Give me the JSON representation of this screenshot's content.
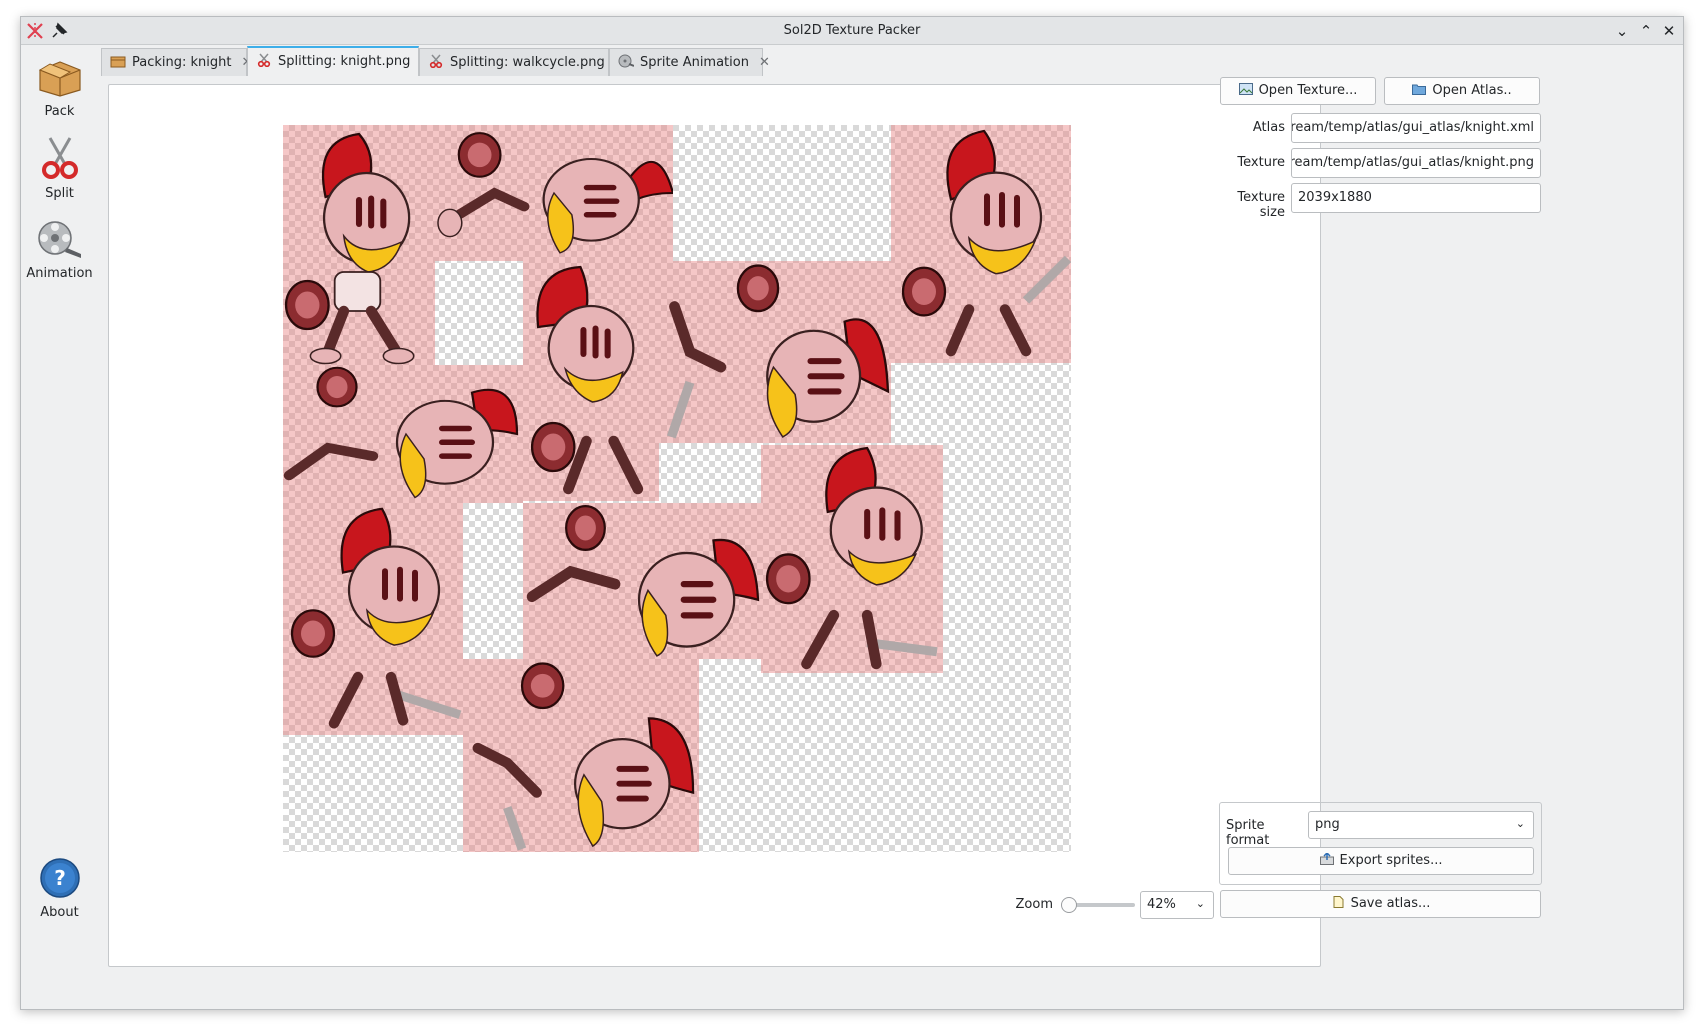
{
  "window": {
    "title": "Sol2D Texture Packer"
  },
  "sidebar": {
    "items": [
      {
        "label": "Pack",
        "icon": "box-icon"
      },
      {
        "label": "Split",
        "icon": "scissors-icon"
      },
      {
        "label": "Animation",
        "icon": "film-reel-icon"
      },
      {
        "label": "About",
        "icon": "help-icon"
      }
    ]
  },
  "tabs": [
    {
      "label": "Packing: knight",
      "icon": "box-icon"
    },
    {
      "label": "Splitting: knight.png",
      "icon": "scissors-icon",
      "active": true
    },
    {
      "label": "Splitting: walkcycle.png",
      "icon": "scissors-icon"
    },
    {
      "label": "Sprite Animation",
      "icon": "film-reel-icon"
    }
  ],
  "right_panel": {
    "open_texture_label": "Open Texture...",
    "open_atlas_label": "Open Atlas..",
    "atlas_label": "Atlas",
    "atlas_value": "instream/temp/atlas/gui_atlas/knight.xml",
    "texture_label": "Texture",
    "texture_value": "instream/temp/atlas/gui_atlas/knight.png",
    "texture_size_label": "Texture size",
    "texture_size_value": "2039x1880",
    "sprite_format_label": "Sprite format",
    "sprite_format_value": "png",
    "export_sprites_label": "Export sprites...",
    "save_atlas_label": "Save atlas..."
  },
  "zoom": {
    "label": "Zoom",
    "value": "42%",
    "level_percent": 42
  },
  "colors": {
    "accent": "#3daee9",
    "sprite_frame_tint": "#e88282"
  }
}
